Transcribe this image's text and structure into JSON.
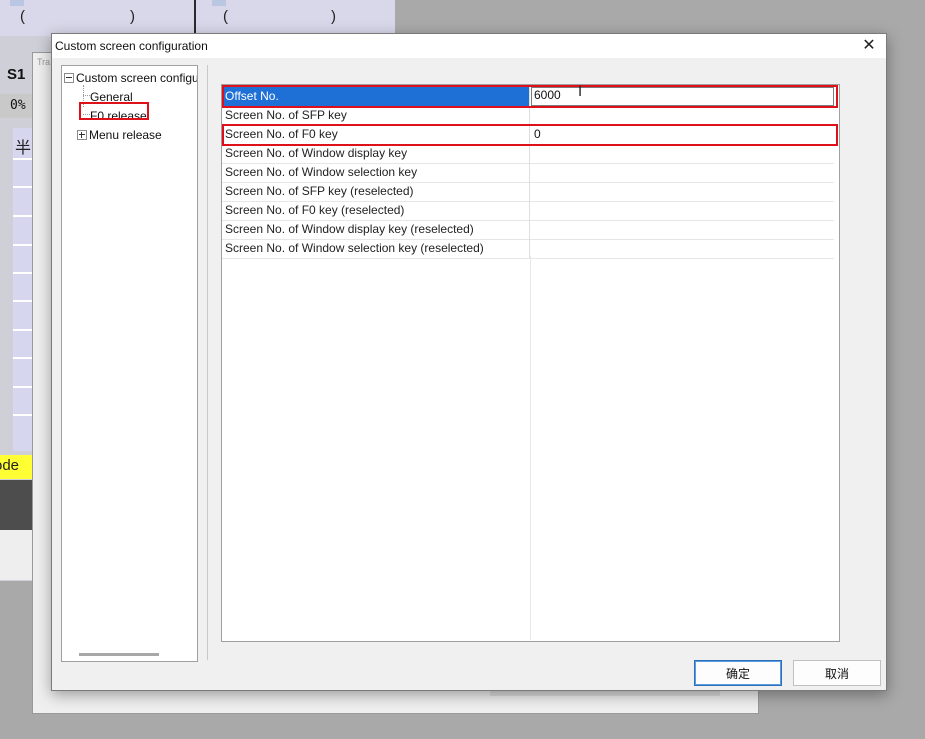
{
  "background": {
    "paren_left_1": "(",
    "paren_right_1": ")",
    "paren_left_2": "(",
    "paren_right_2": ")",
    "s1_label": "S1",
    "percent": "0%",
    "kanji": "半",
    "mode_fragment": "ode",
    "window2_label": "Tra"
  },
  "dialog": {
    "title": "Custom screen configuration",
    "close_glyph": "✕",
    "tree": {
      "root": "Custom screen configu",
      "items": [
        {
          "label": "General"
        },
        {
          "label": "F0 release"
        },
        {
          "label": "Menu release"
        }
      ]
    },
    "properties": [
      {
        "name": "Offset No.",
        "value": "6000"
      },
      {
        "name": "Screen No. of SFP key",
        "value": ""
      },
      {
        "name": "Screen No. of F0 key",
        "value": "0"
      },
      {
        "name": "Screen No. of Window display key",
        "value": ""
      },
      {
        "name": "Screen No. of Window selection key",
        "value": ""
      },
      {
        "name": "Screen No. of SFP key (reselected)",
        "value": ""
      },
      {
        "name": "Screen No. of F0 key (reselected)",
        "value": ""
      },
      {
        "name": "Screen No. of Window display key (reselected)",
        "value": ""
      },
      {
        "name": "Screen No. of Window selection key (reselected)",
        "value": ""
      }
    ],
    "buttons": {
      "ok": "确定",
      "cancel": "取消"
    },
    "colors": {
      "selection": "#1e6fd6",
      "highlight_box": "#e0101a"
    }
  }
}
